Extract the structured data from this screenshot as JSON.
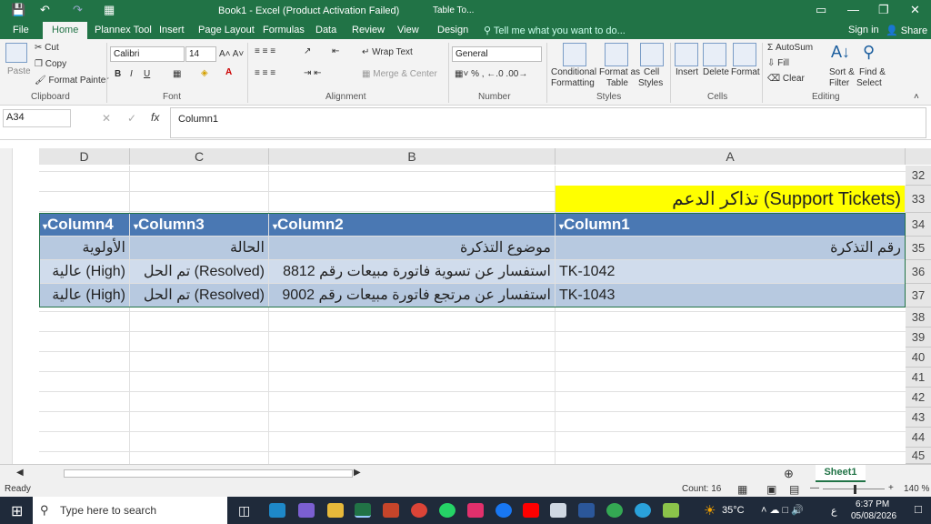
{
  "window": {
    "title": "Book1 - Excel (Product Activation Failed)",
    "context_tab": "Table To...",
    "save_icon": "save-icon",
    "undo_icon": "undo-icon"
  },
  "account": {
    "sign_in": "Sign in",
    "share": "Share",
    "tell_me": "Tell me what you want to do..."
  },
  "tabs": [
    "File",
    "Home",
    "Plannex Tool",
    "Insert",
    "Page Layout",
    "Formulas",
    "Data",
    "Review",
    "View",
    "Design"
  ],
  "ribbon": {
    "clipboard": {
      "paste": "Paste",
      "cut": "Cut",
      "copy": "Copy",
      "format_painter": "Format Painter",
      "group": "Clipboard"
    },
    "font": {
      "name": "Calibri",
      "size": "14",
      "group": "Font"
    },
    "alignment": {
      "wrap": "Wrap Text",
      "merge": "Merge & Center",
      "group": "Alignment"
    },
    "number": {
      "format": "General",
      "group": "Number"
    },
    "styles": {
      "cond1": "Conditional",
      "cond2": "Formatting",
      "fmt1": "Format as",
      "fmt2": "Table",
      "cell1": "Cell",
      "cell2": "Styles",
      "group": "Styles"
    },
    "cells": {
      "insert": "Insert",
      "delete": "Delete",
      "format": "Format",
      "group": "Cells"
    },
    "editing": {
      "autosum": "AutoSum",
      "fill": "Fill",
      "clear": "Clear",
      "sort1": "Sort &",
      "sort2": "Filter",
      "find1": "Find &",
      "find2": "Select",
      "group": "Editing"
    }
  },
  "formula_bar": {
    "name_box": "A34",
    "content": "Column1"
  },
  "columns": [
    "D",
    "C",
    "B",
    "A"
  ],
  "rows": [
    "32",
    "33",
    "34",
    "35",
    "36",
    "37",
    "38",
    "39",
    "40",
    "41",
    "42",
    "43",
    "44",
    "45"
  ],
  "sheet": {
    "title": "تذاكر الدعم (Support Tickets)",
    "headers": [
      "Column4",
      "Column3",
      "Column2",
      "Column1"
    ],
    "labels": [
      "الأولوية",
      "الحالة",
      "موضوع التذكرة",
      "رقم التذكرة"
    ],
    "data": [
      [
        "عالية (High)",
        "تم الحل (Resolved)",
        "استفسار عن تسوية فاتورة مبيعات رقم 8812",
        "TK-1042"
      ],
      [
        "عالية (High)",
        "تم الحل (Resolved)",
        "استفسار عن مرتجع فاتورة مبيعات رقم 9002",
        "TK-1043"
      ]
    ]
  },
  "sheet_tab": "Sheet1",
  "status": {
    "ready": "Ready",
    "count": "Count: 16",
    "zoom": "140 %"
  },
  "taskbar": {
    "search": "Type here to search",
    "temp": "35°C",
    "time": "6:37 PM",
    "date": "05/08/2026",
    "lang": "ع"
  },
  "colors": {
    "excel_green": "#217346",
    "table_header": "#4a78b3",
    "title_fill": "#ffff00"
  }
}
